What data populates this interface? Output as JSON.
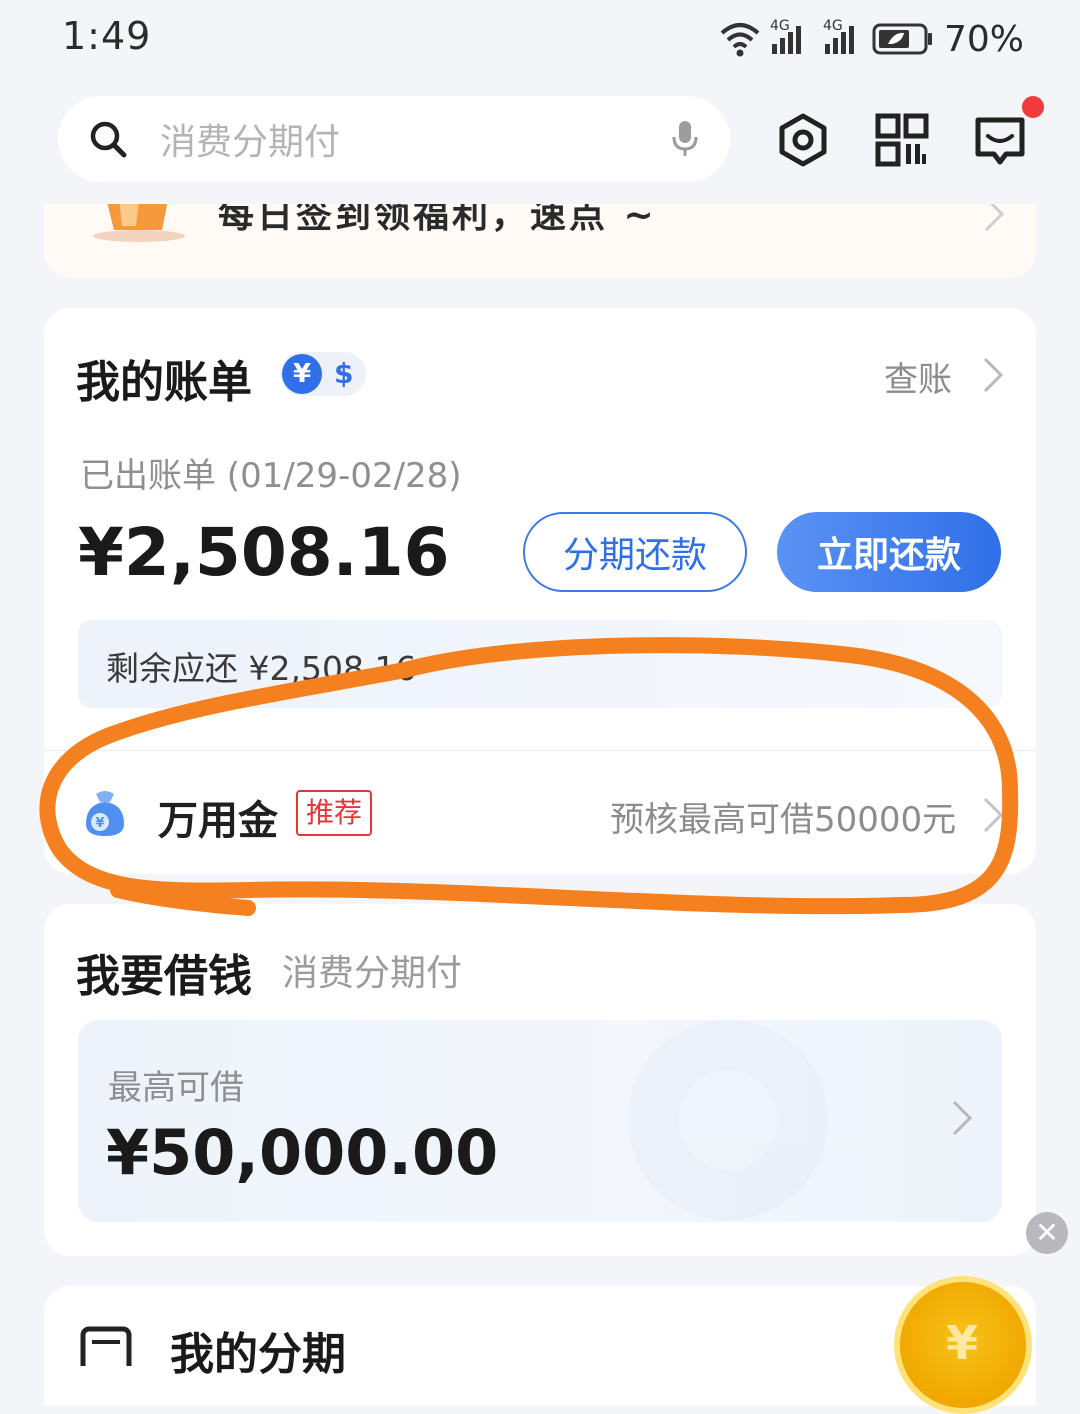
{
  "status_bar": {
    "time": "1:49",
    "network_1": "4G",
    "network_2": "4G",
    "battery": "70%"
  },
  "search": {
    "placeholder": "消费分期付"
  },
  "signin_banner": {
    "text": "每日签到领福利，速点 ~"
  },
  "bill": {
    "title": "我的账单",
    "currency_yen": "¥",
    "currency_usd": "$",
    "view_link": "查账",
    "period": "已出账单 (01/29-02/28)",
    "amount": "¥2,508.16",
    "installment_button": "分期还款",
    "pay_button": "立即还款",
    "remaining": "剩余应还 ¥2,508.16",
    "product_name": "万用金",
    "product_tag": "推荐",
    "product_desc": "预核最高可借50000元"
  },
  "borrow": {
    "title": "我要借钱",
    "subtitle": "消费分期付",
    "max_label": "最高可借",
    "max_amount": "¥50,000.00"
  },
  "installments": {
    "title": "我的分期"
  },
  "floating": {
    "close": "✕",
    "coin_symbol": "¥"
  },
  "colors": {
    "accent": "#2f6fe8",
    "annotation": "#f5801f",
    "badge_red": "#e2373a"
  }
}
